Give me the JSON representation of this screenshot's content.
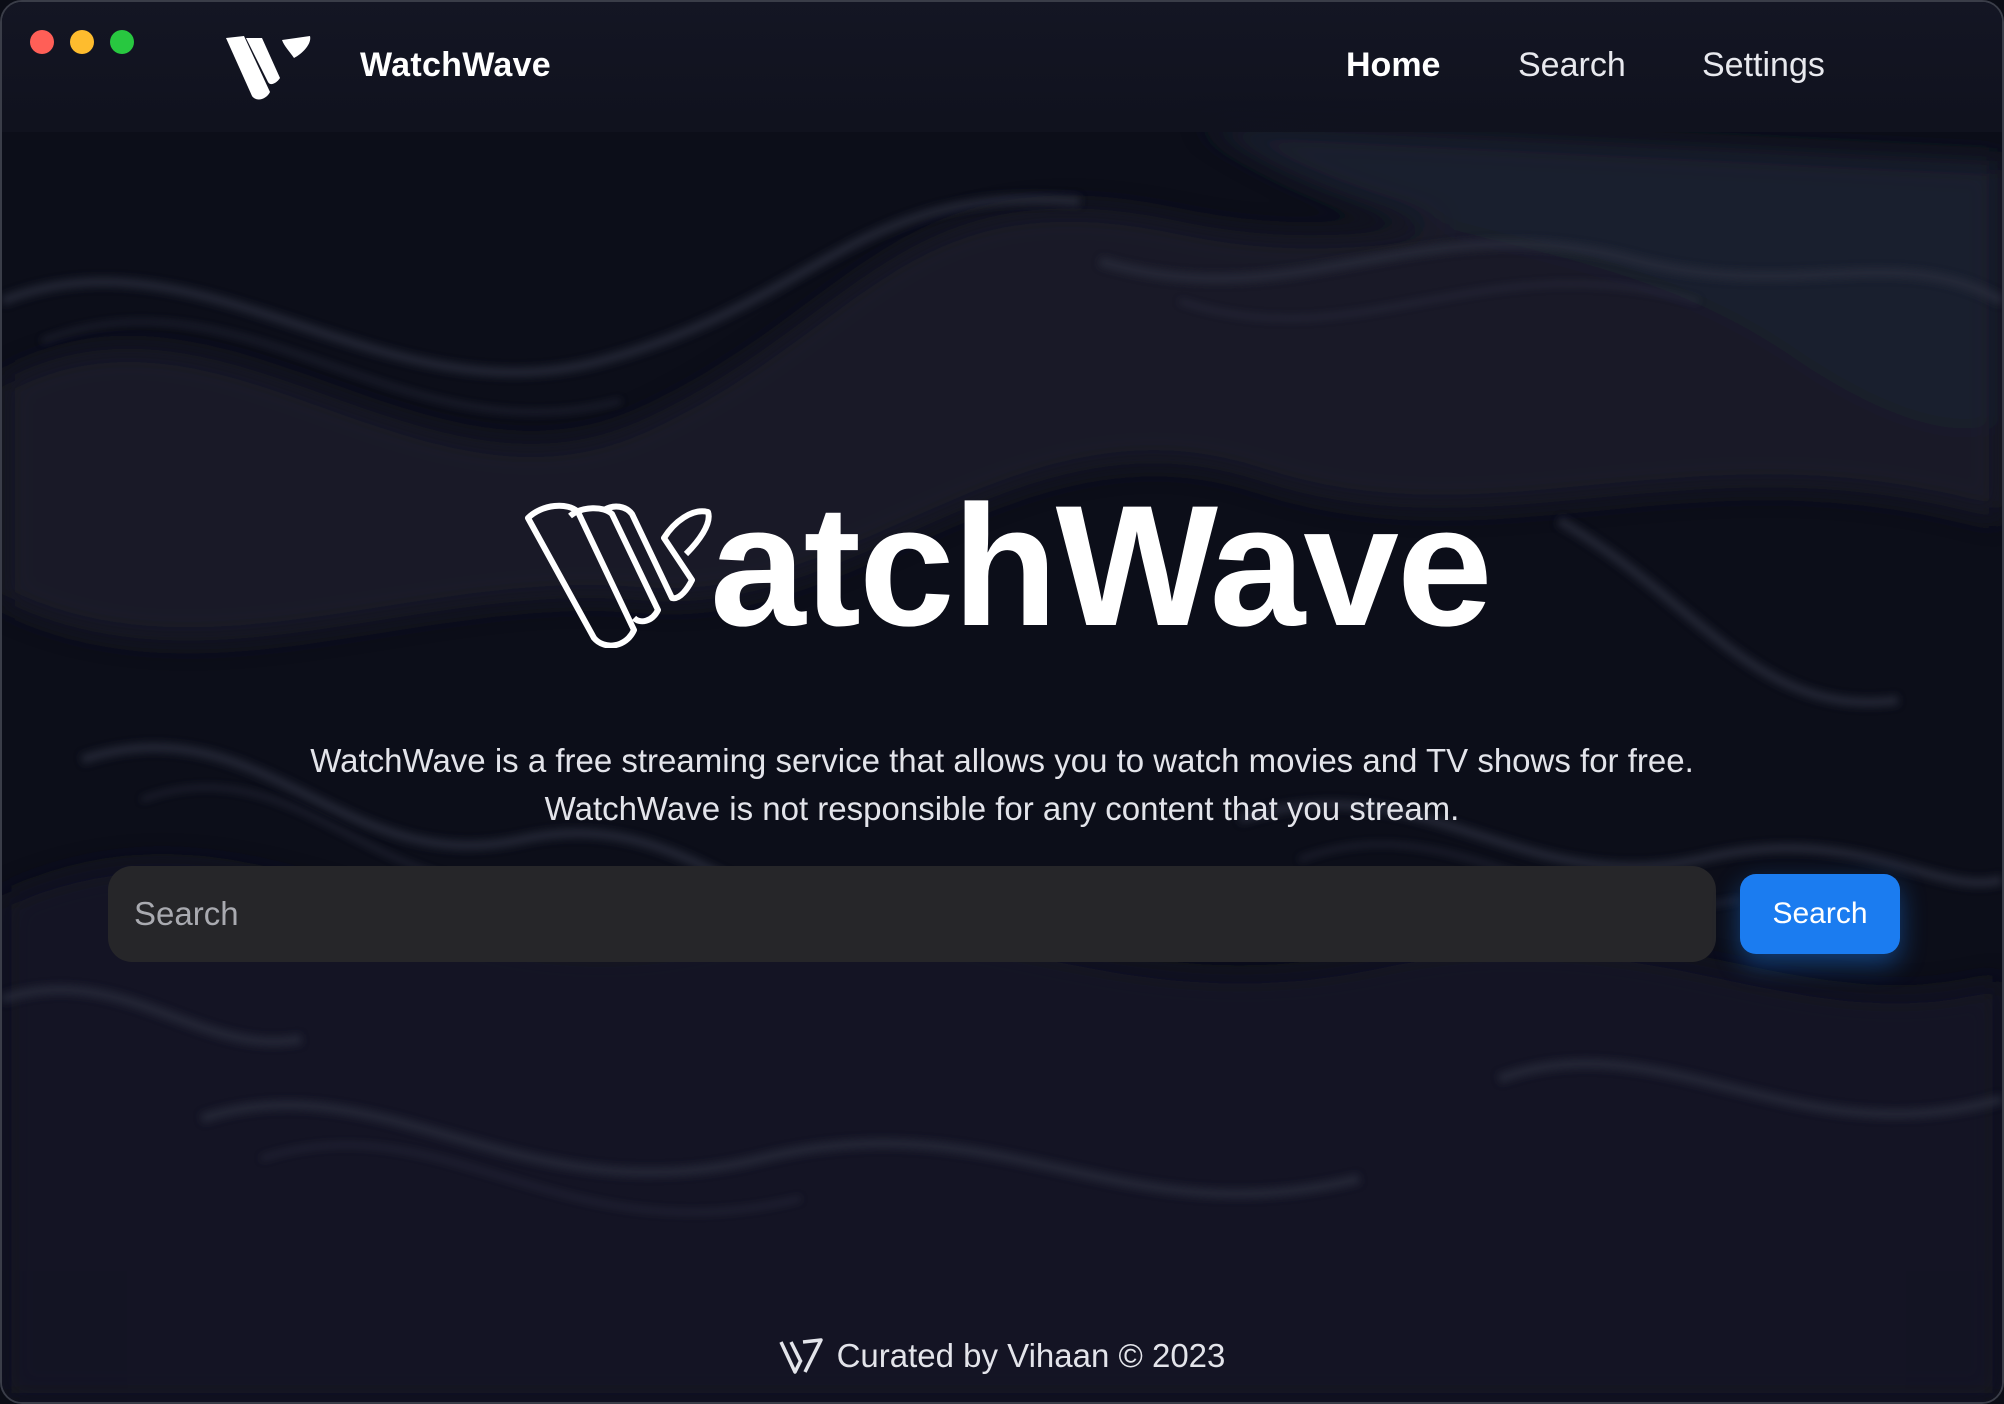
{
  "window": {
    "controls": [
      "close",
      "minimize",
      "zoom"
    ]
  },
  "header": {
    "brand_name": "WatchWave",
    "brand_icon": "watchwave-logo-icon",
    "nav": [
      {
        "label": "Home",
        "active": true
      },
      {
        "label": "Search",
        "active": false
      },
      {
        "label": "Settings",
        "active": false
      }
    ]
  },
  "hero": {
    "logo_icon": "watchwave-outline-w-icon",
    "title_rest": "atchWave",
    "description_line1": "WatchWave is a free streaming service that allows you to watch movies and TV shows for free.",
    "description_line2": "WatchWave is not responsible for any content that you stream."
  },
  "search": {
    "placeholder": "Search",
    "value": "",
    "button_label": "Search"
  },
  "footer": {
    "icon": "watchwave-small-logo-icon",
    "text": "Curated by Vihaan © 2023"
  },
  "colors": {
    "background": "#0c0e19",
    "accent": "#1b7cf0",
    "input_bg": "#262629",
    "text": "#ffffff"
  }
}
